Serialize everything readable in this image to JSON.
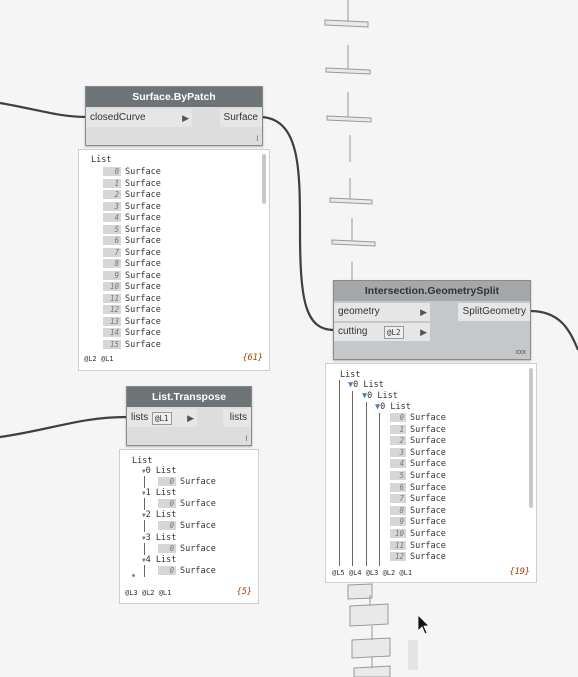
{
  "nodes": {
    "surface_bypatch": {
      "title": "Surface.ByPatch",
      "inputs": [
        "closedCurve"
      ],
      "outputs": [
        "Surface"
      ],
      "lacing": "l"
    },
    "list_transpose": {
      "title": "List.Transpose",
      "inputs": [
        "lists"
      ],
      "input_level": "@L1",
      "outputs": [
        "lists"
      ],
      "lacing": "l"
    },
    "intersection_split": {
      "title": "Intersection.GeometrySplit",
      "inputs": [
        "geometry",
        "cutting"
      ],
      "cutting_level": "@L2",
      "outputs": [
        "SplitGeometry"
      ],
      "lacing": "xxx"
    }
  },
  "previews": {
    "patch": {
      "header": "List",
      "indices": [
        "0",
        "1",
        "2",
        "3",
        "4",
        "5",
        "6",
        "7",
        "8",
        "9",
        "10",
        "11",
        "12",
        "13",
        "14",
        "15"
      ],
      "item_label": "Surface",
      "levels": "@L2 @L1",
      "count": "{61}"
    },
    "transpose": {
      "header": "List",
      "groups": [
        {
          "label": "0 List",
          "item_index": "0",
          "item_label": "Surface"
        },
        {
          "label": "1 List",
          "item_index": "0",
          "item_label": "Surface"
        },
        {
          "label": "2 List",
          "item_index": "0",
          "item_label": "Surface"
        },
        {
          "label": "3 List",
          "item_index": "0",
          "item_label": "Surface"
        },
        {
          "label": "4 List",
          "item_index": "0",
          "item_label": "Surface"
        }
      ],
      "levels": "@L3 @L2 @L1",
      "count": "{5}"
    },
    "split": {
      "header": "List",
      "nested": [
        "0 List",
        "0 List",
        "0 List"
      ],
      "indices": [
        "0",
        "1",
        "2",
        "3",
        "4",
        "5",
        "6",
        "7",
        "8",
        "9",
        "10",
        "11",
        "12"
      ],
      "item_label": "Surface",
      "levels": "@L5 @L4 @L3 @L2 @L1",
      "count": "{19}"
    }
  },
  "colors": {
    "canvas": "#f5f5f5",
    "node_header": "#6c7478",
    "node_header_selected": "#a4a8aa",
    "wire": "#3f3f3f",
    "count_text": "#a04000"
  }
}
